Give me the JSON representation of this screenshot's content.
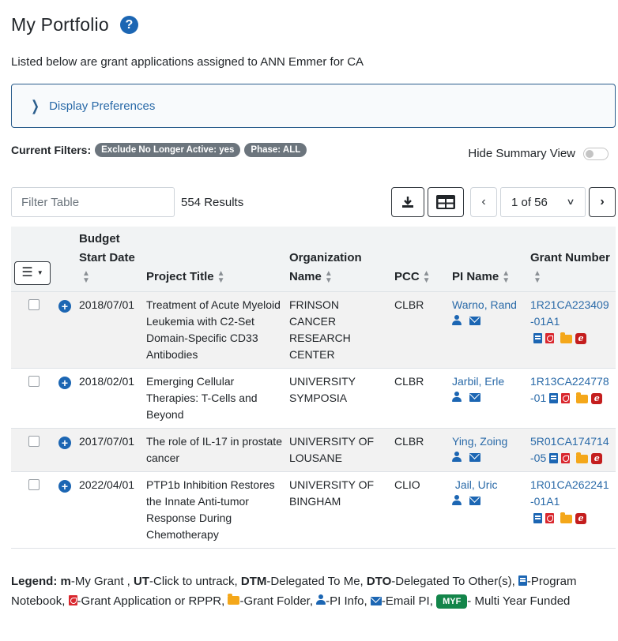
{
  "page": {
    "title": "My Portfolio",
    "help_icon": "question-circle-icon",
    "subtitle": "Listed below are grant applications assigned to ANN Emmer for CA"
  },
  "preferences": {
    "label": "Display Preferences"
  },
  "filters": {
    "label": "Current Filters:",
    "badges": [
      "Exclude No Longer Active: yes",
      "Phase: ALL"
    ]
  },
  "summary_toggle": {
    "label": "Hide Summary View",
    "on": false
  },
  "toolbar": {
    "filter_placeholder": "Filter Table",
    "results": "554 Results",
    "download_icon": "download-icon",
    "grid_icon": "table-grid-icon",
    "pager": "1 of 56"
  },
  "table": {
    "headers": {
      "budget": "Budget Start Date",
      "title": "Project Title",
      "org": "Organization Name",
      "pcc": "PCC",
      "pi": "PI Name",
      "grant": "Grant Number"
    },
    "rows": [
      {
        "date": "2018/07/01",
        "title": "Treatment of Acute Myeloid Leukemia with C2-Set Domain-Specific CD33 Antibodies",
        "org": "FRINSON CANCER RESEARCH CENTER",
        "pcc": "CLBR",
        "pi": "Warno, Rand",
        "grant": "1R21CA223409-01A1"
      },
      {
        "date": "2018/02/01",
        "title": "Emerging Cellular Therapies: T-Cells and Beyond",
        "org": "UNIVERSITY SYMPOSIA",
        "pcc": "CLBR",
        "pi": "Jarbil, Erle",
        "grant": "1R13CA224778-01"
      },
      {
        "date": "2017/07/01",
        "title": "The role of IL-17 in prostate cancer",
        "org": "UNIVERSITY OF LOUSANE",
        "pcc": "CLBR",
        "pi": "Ying, Zoing",
        "grant": "5R01CA174714-05"
      },
      {
        "date": "2022/04/01",
        "title": "PTP1b Inhibition Restores the Innate Anti-tumor Response During Chemotherapy",
        "org": "UNIVERSITY OF BINGHAM",
        "pcc": "CLIO",
        "pi": " Jail, Uric",
        "grant": "1R01CA262241-01A1"
      }
    ]
  },
  "legend": {
    "prefix": "Legend: ",
    "m": "m",
    "m_text": "-My Grant , ",
    "ut": "UT",
    "ut_text": "-Click to untrack, ",
    "dtm": "DTM",
    "dtm_text": "-Delegated To Me, ",
    "dto": "DTO",
    "dto_text": "-Delegated To Other(s), ",
    "notebook_text": "-Program Notebook, ",
    "pdf_text": "-Grant Application or RPPR, ",
    "folder_text": "-Grant Folder, ",
    "pi_text": "-PI Info, ",
    "email_text": "-Email PI, ",
    "myf": "MYF",
    "myf_text": "- Multi Year Funded"
  }
}
